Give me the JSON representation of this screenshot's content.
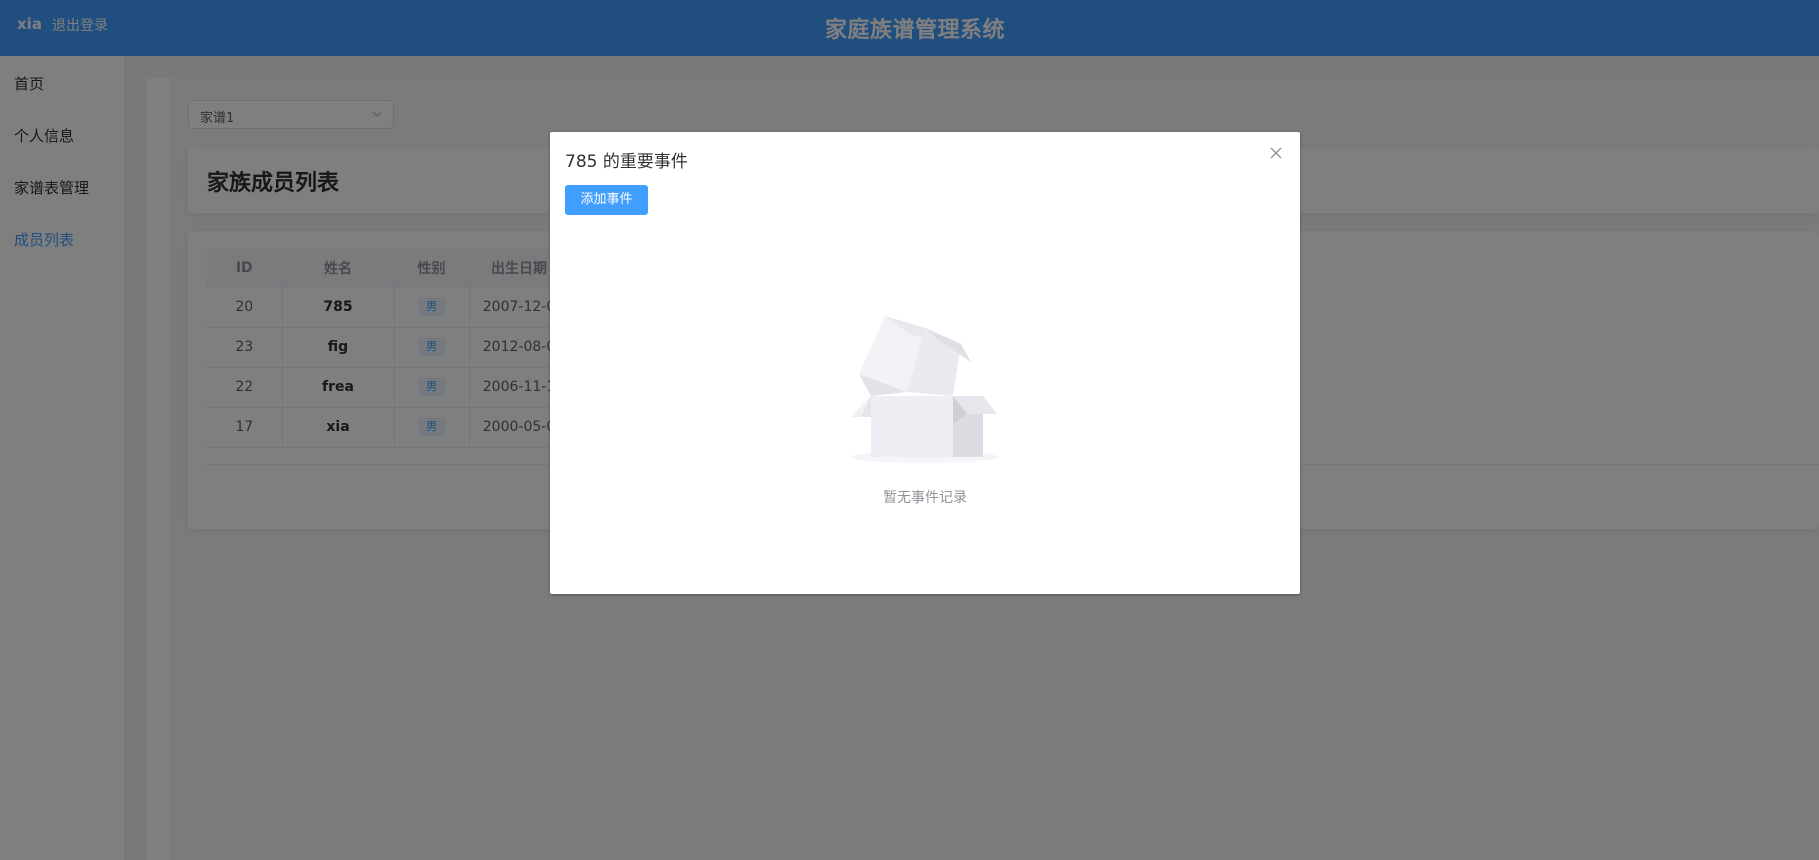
{
  "header": {
    "user": "xia",
    "logout_label": "退出登录",
    "title": "家庭族谱管理系统"
  },
  "sidebar": {
    "items": [
      {
        "label": "首页"
      },
      {
        "label": "个人信息"
      },
      {
        "label": "家谱表管理"
      },
      {
        "label": "成员列表"
      }
    ]
  },
  "filter": {
    "selected": "家谱1"
  },
  "page": {
    "title": "家族成员列表"
  },
  "table": {
    "columns": [
      "ID",
      "姓名",
      "性别",
      "出生日期"
    ],
    "rows": [
      {
        "id": "20",
        "name": "785",
        "gender": "男",
        "birth": "2007-12-0"
      },
      {
        "id": "23",
        "name": "fig",
        "gender": "男",
        "birth": "2012-08-0"
      },
      {
        "id": "22",
        "name": "frea",
        "gender": "男",
        "birth": "2006-11-1"
      },
      {
        "id": "17",
        "name": "xia",
        "gender": "男",
        "birth": "2000-05-0"
      }
    ]
  },
  "dialog": {
    "title": "785 的重要事件",
    "add_label": "添加事件",
    "empty_text": "暂无事件记录"
  },
  "colors": {
    "primary": "#409eff",
    "mask": "rgba(0,0,0,0.5)"
  }
}
